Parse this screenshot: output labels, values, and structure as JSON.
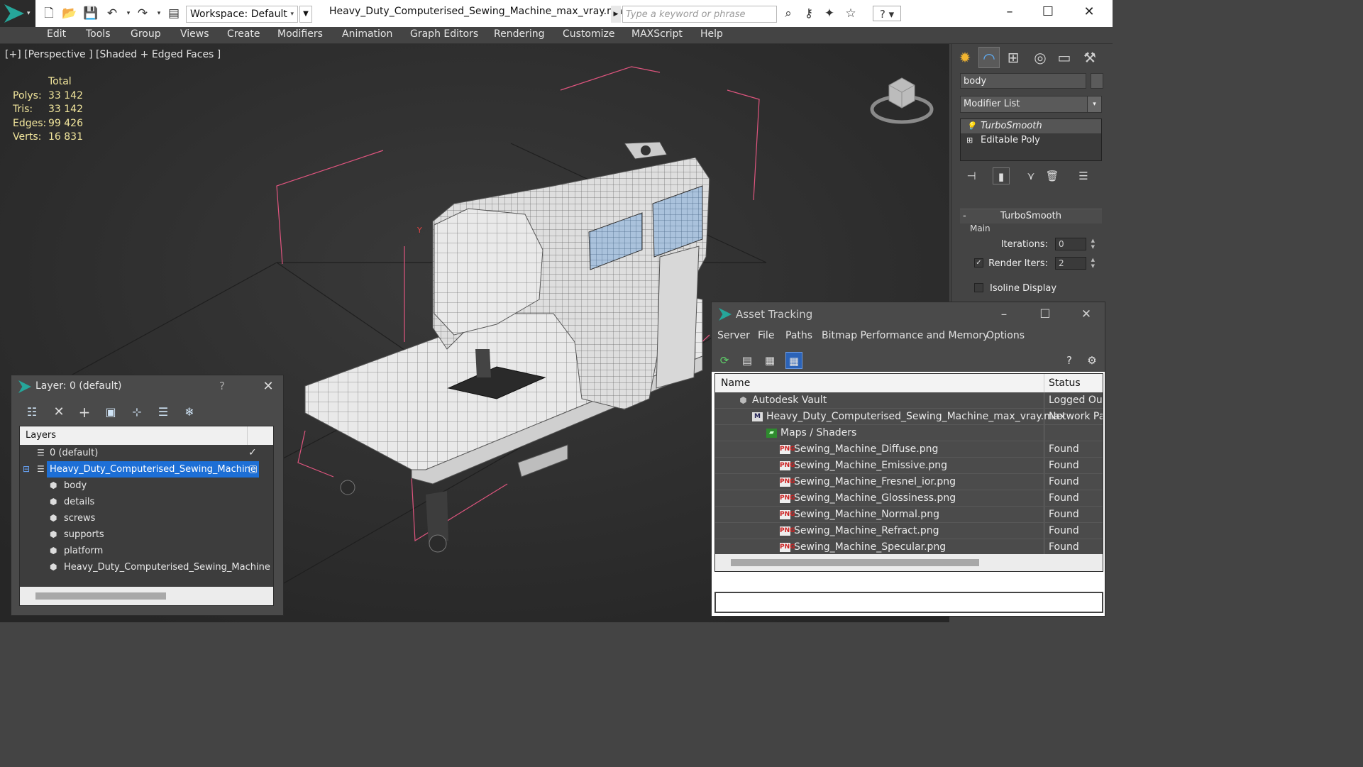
{
  "titlebar": {
    "workspace_label": "Workspace: Default",
    "document_title": "Heavy_Duty_Computerised_Sewing_Machine_max_vray.max",
    "search_placeholder": "Type a keyword or phrase",
    "minimize": "–",
    "maximize": "☐",
    "close": "✕"
  },
  "menu": [
    "Edit",
    "Tools",
    "Group",
    "Views",
    "Create",
    "Modifiers",
    "Animation",
    "Graph Editors",
    "Rendering",
    "Customize",
    "MAXScript",
    "Help"
  ],
  "viewport": {
    "label": "[+] [Perspective ] [Shaded + Edged Faces ]",
    "stats": {
      "header": "Total",
      "rows": [
        {
          "key": "Polys:",
          "value": "33 142"
        },
        {
          "key": "Tris:",
          "value": "33 142"
        },
        {
          "key": "Edges:",
          "value": "99 426"
        },
        {
          "key": "Verts:",
          "value": "16 831"
        }
      ]
    },
    "axis_label": "Y"
  },
  "command_panel": {
    "object_name": "body",
    "modifier_list": "Modifier List",
    "stack": [
      "TurboSmooth",
      "Editable Poly"
    ],
    "rollout_title": "TurboSmooth",
    "group_main": "Main",
    "iterations_label": "Iterations:",
    "iterations_value": "0",
    "render_iters_label": "Render Iters:",
    "render_iters_value": "2",
    "render_iters_checked": true,
    "isoline_label": "Isoline Display",
    "isoline_checked": false
  },
  "layer_window": {
    "title": "Layer: 0 (default)",
    "help": "?",
    "column": "Layers",
    "rows": [
      {
        "name": "0 (default)"
      },
      {
        "name": "Heavy_Duty_Computerised_Sewing_Machine"
      },
      {
        "name": "body"
      },
      {
        "name": "details"
      },
      {
        "name": "screws"
      },
      {
        "name": "supports"
      },
      {
        "name": "platform"
      },
      {
        "name": "Heavy_Duty_Computerised_Sewing_Machine"
      }
    ]
  },
  "asset_window": {
    "title": "Asset Tracking",
    "menu": [
      "Server",
      "File",
      "Paths",
      "Bitmap Performance and Memory",
      "Options"
    ],
    "col_name": "Name",
    "col_status": "Status",
    "rows": [
      {
        "name": "Autodesk Vault",
        "status": "Logged Out",
        "icon": "vault-icon"
      },
      {
        "name": "Heavy_Duty_Computerised_Sewing_Machine_max_vray.max",
        "status": "Network Path",
        "icon": "max-file-icon"
      },
      {
        "name": "Maps / Shaders",
        "status": "",
        "icon": "maps-icon"
      },
      {
        "name": "Sewing_Machine_Diffuse.png",
        "status": "Found",
        "icon": "png-icon"
      },
      {
        "name": "Sewing_Machine_Emissive.png",
        "status": "Found",
        "icon": "png-icon"
      },
      {
        "name": "Sewing_Machine_Fresnel_ior.png",
        "status": "Found",
        "icon": "png-icon"
      },
      {
        "name": "Sewing_Machine_Glossiness.png",
        "status": "Found",
        "icon": "png-icon"
      },
      {
        "name": "Sewing_Machine_Normal.png",
        "status": "Found",
        "icon": "png-icon"
      },
      {
        "name": "Sewing_Machine_Refract.png",
        "status": "Found",
        "icon": "png-icon"
      },
      {
        "name": "Sewing_Machine_Specular.png",
        "status": "Found",
        "icon": "png-icon"
      }
    ]
  },
  "colors": {
    "accent_teal": "#26a69a",
    "selection_blue": "#1d6fd6",
    "stats_yellow": "#f2e69c",
    "bbox_pink": "#e0557f"
  }
}
